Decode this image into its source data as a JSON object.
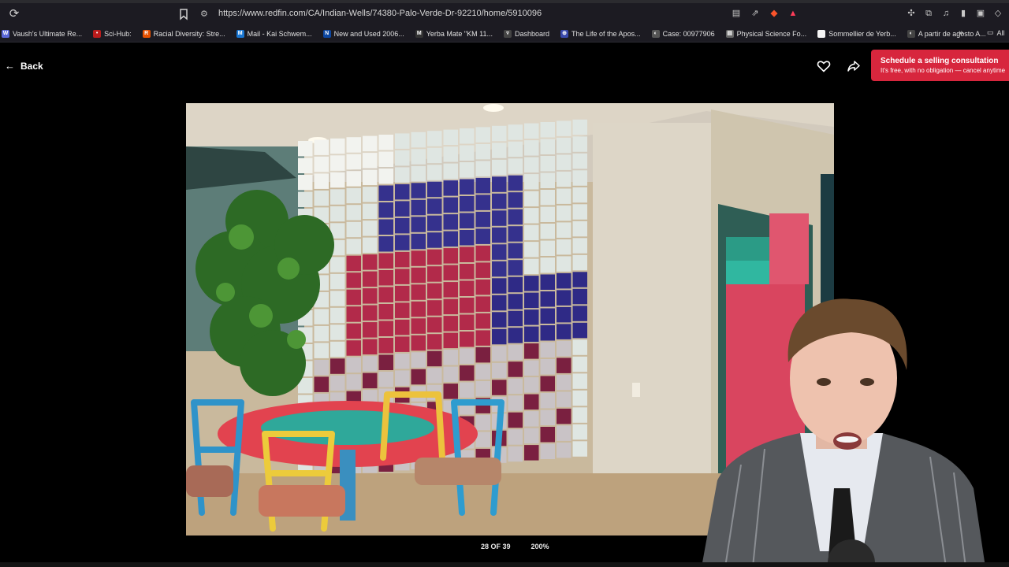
{
  "browser": {
    "url": "https://www.redfin.com/CA/Indian-Wells/74380-Palo-Verde-Dr-92210/home/5910096",
    "bookmarks": [
      {
        "label": "Vaush's Ultimate Re...",
        "color": "#5a67d8",
        "glyph": "W"
      },
      {
        "label": "Sci-Hub:",
        "color": "#b91c1c",
        "glyph": "•"
      },
      {
        "label": "Racial Diversity: Stre...",
        "color": "#e65100",
        "glyph": "R"
      },
      {
        "label": "Mail - Kai Schwem...",
        "color": "#1976d2",
        "glyph": "M"
      },
      {
        "label": "New and Used 2006...",
        "color": "#0d47a1",
        "glyph": "N"
      },
      {
        "label": "Yerba Mate \"KM 11...",
        "color": "#333333",
        "glyph": "M"
      },
      {
        "label": "Dashboard",
        "color": "#444444",
        "glyph": "▿"
      },
      {
        "label": "The Life of the Apos...",
        "color": "#3949ab",
        "glyph": "⊕"
      },
      {
        "label": "Case: 00977906",
        "color": "#555555",
        "glyph": "◐"
      },
      {
        "label": "Physical Science Fo...",
        "color": "#666666",
        "glyph": "▤"
      },
      {
        "label": "Sommellier de Yerb...",
        "color": "#f5f5f5",
        "glyph": ""
      },
      {
        "label": "A partir de agosto A...",
        "color": "#444444",
        "glyph": "◐"
      }
    ],
    "all_bookmarks_label": "All"
  },
  "page": {
    "back_label": "Back",
    "cta_title": "Schedule a selling consultation",
    "cta_subtitle": "It's free, with no obligation — cancel anytime",
    "photo_counter": "28 OF 39",
    "zoom": "200%"
  },
  "icons": {
    "reload": "reload-icon",
    "bookmark": "bookmark-icon",
    "favorite": "heart-icon",
    "share": "share-icon"
  }
}
